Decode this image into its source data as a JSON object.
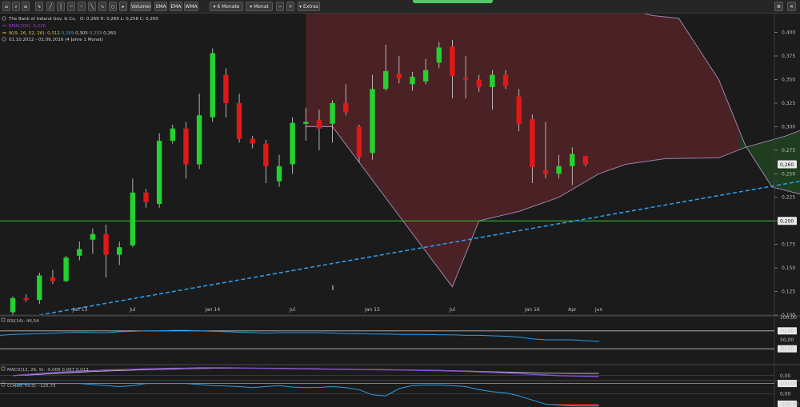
{
  "toolbar": {
    "buttons": [
      {
        "id": "tb-home",
        "label": "⌂"
      },
      {
        "id": "tb-zoom",
        "label": "⌕"
      },
      {
        "id": "tb-list",
        "label": "≡"
      },
      {
        "id": "tb-d1",
        "label": "↳"
      },
      {
        "id": "tb-d2",
        "label": "╱"
      },
      {
        "id": "tb-d3",
        "label": "│"
      },
      {
        "id": "tb-d4",
        "label": "─"
      },
      {
        "id": "tb-d5",
        "label": "┄"
      },
      {
        "id": "tb-d6",
        "label": "╲"
      },
      {
        "id": "tb-d7",
        "label": "∿"
      },
      {
        "id": "tb-d8",
        "label": "○"
      },
      {
        "id": "tb-d9",
        "label": "▸"
      },
      {
        "id": "tb-volumen",
        "label": "Volumen"
      },
      {
        "id": "tb-sma",
        "label": "SMA"
      },
      {
        "id": "tb-ema",
        "label": "EMA"
      },
      {
        "id": "tb-wma",
        "label": "WMA"
      },
      {
        "id": "tb-range",
        "label": "▾ 6 Monate"
      },
      {
        "id": "tb-interval",
        "label": "▾ Monat"
      },
      {
        "id": "tb-minus",
        "label": "−"
      },
      {
        "id": "tb-plus",
        "label": "+"
      },
      {
        "id": "tb-extras",
        "label": "▾ Extras"
      },
      {
        "id": "tb-settings",
        "label": "⚙"
      },
      {
        "id": "tb-close",
        "label": "✕"
      }
    ]
  },
  "legend": {
    "instrument": "The Bank of Ireland Gov. & Co.",
    "ohlc": "O: 0,269  H: 0,269  L: 0,258  C: 0,260",
    "ema": "EMA(200): 0,226",
    "ichimoku_label": "IK(9, 26, 52, 26): ",
    "ichimoku_v1": "0,312",
    "ichimoku_v2": "0,269",
    "ichimoku_v3": "0,305",
    "ichimoku_v4": "0,233",
    "ichimoku_v5": "0,260",
    "period": "01.10.2012 - 01.06.2016 (4 Jahre 1 Monat)"
  },
  "panels": {
    "rsi_label": "RSI(14): 46,54",
    "macd_label": "MACD(12, 26, 9): -0,005  0,007  0,013",
    "cci_label": "CCI(20, hlc3): -125,73"
  },
  "colors": {
    "up": "#22d22e",
    "down": "#e01818",
    "cloud_red": "#4a2124",
    "cloud_green": "#1e3e1f",
    "cloud_line": "#9a84b2",
    "trend": "#2d9be8",
    "hline": "#37c837",
    "rsi": "#2e9be8",
    "macd": "#8a4fd8",
    "cci_fill": "#1de11d",
    "cci_neg": "#e02020"
  },
  "chart_data": [
    {
      "type": "candlestick",
      "title": "The Bank of Ireland Gov. & Co.",
      "ylim": [
        0.1,
        0.42
      ],
      "yticks": [
        "0,400",
        "0,375",
        "0,350",
        "0,325",
        "0,300",
        "0,275",
        "0,250",
        "0,225",
        "0,200",
        "0,175",
        "0,150",
        "0,125",
        "0,100"
      ],
      "ytick_values": [
        0.4,
        0.375,
        0.35,
        0.325,
        0.3,
        0.275,
        0.25,
        0.225,
        0.2,
        0.175,
        0.15,
        0.125,
        0.1
      ],
      "x_index_range": [
        0,
        44
      ],
      "xticks": [
        {
          "label": "Jan 13",
          "i": 3
        },
        {
          "label": "Jul",
          "i": 9
        },
        {
          "label": "Jan 14",
          "i": 15
        },
        {
          "label": "Jul",
          "i": 21
        },
        {
          "label": "Jan 15",
          "i": 27
        },
        {
          "label": "Jul",
          "i": 33
        },
        {
          "label": "Jan 16",
          "i": 39
        },
        {
          "label": "Apr",
          "i": 42
        },
        {
          "label": "Jun",
          "i": 44
        }
      ],
      "candles": [
        {
          "o": 0.103,
          "h": 0.12,
          "l": 0.1,
          "c": 0.118
        },
        {
          "o": 0.118,
          "h": 0.122,
          "l": 0.114,
          "c": 0.116
        },
        {
          "o": 0.116,
          "h": 0.145,
          "l": 0.112,
          "c": 0.142
        },
        {
          "o": 0.14,
          "h": 0.148,
          "l": 0.133,
          "c": 0.136
        },
        {
          "o": 0.136,
          "h": 0.163,
          "l": 0.135,
          "c": 0.161
        },
        {
          "o": 0.163,
          "h": 0.178,
          "l": 0.158,
          "c": 0.17
        },
        {
          "o": 0.18,
          "h": 0.192,
          "l": 0.165,
          "c": 0.186
        },
        {
          "o": 0.186,
          "h": 0.196,
          "l": 0.14,
          "c": 0.164
        },
        {
          "o": 0.164,
          "h": 0.178,
          "l": 0.153,
          "c": 0.172
        },
        {
          "o": 0.174,
          "h": 0.245,
          "l": 0.172,
          "c": 0.23
        },
        {
          "o": 0.23,
          "h": 0.234,
          "l": 0.214,
          "c": 0.22
        },
        {
          "o": 0.218,
          "h": 0.293,
          "l": 0.214,
          "c": 0.285
        },
        {
          "o": 0.285,
          "h": 0.302,
          "l": 0.282,
          "c": 0.298
        },
        {
          "o": 0.298,
          "h": 0.305,
          "l": 0.245,
          "c": 0.26
        },
        {
          "o": 0.26,
          "h": 0.335,
          "l": 0.255,
          "c": 0.312
        },
        {
          "o": 0.31,
          "h": 0.383,
          "l": 0.305,
          "c": 0.378
        },
        {
          "o": 0.355,
          "h": 0.362,
          "l": 0.31,
          "c": 0.325
        },
        {
          "o": 0.325,
          "h": 0.335,
          "l": 0.283,
          "c": 0.287
        },
        {
          "o": 0.287,
          "h": 0.29,
          "l": 0.277,
          "c": 0.282
        },
        {
          "o": 0.282,
          "h": 0.286,
          "l": 0.24,
          "c": 0.258
        },
        {
          "o": 0.242,
          "h": 0.27,
          "l": 0.236,
          "c": 0.258
        },
        {
          "o": 0.26,
          "h": 0.31,
          "l": 0.25,
          "c": 0.304
        },
        {
          "o": 0.303,
          "h": 0.32,
          "l": 0.285,
          "c": 0.305
        },
        {
          "o": 0.307,
          "h": 0.318,
          "l": 0.275,
          "c": 0.298
        },
        {
          "o": 0.303,
          "h": 0.328,
          "l": 0.283,
          "c": 0.325
        },
        {
          "o": 0.325,
          "h": 0.345,
          "l": 0.312,
          "c": 0.315
        },
        {
          "o": 0.3,
          "h": 0.302,
          "l": 0.262,
          "c": 0.268
        },
        {
          "o": 0.272,
          "h": 0.355,
          "l": 0.265,
          "c": 0.34
        },
        {
          "o": 0.34,
          "h": 0.387,
          "l": 0.338,
          "c": 0.359
        },
        {
          "o": 0.356,
          "h": 0.375,
          "l": 0.346,
          "c": 0.351
        },
        {
          "o": 0.345,
          "h": 0.358,
          "l": 0.338,
          "c": 0.353
        },
        {
          "o": 0.348,
          "h": 0.372,
          "l": 0.345,
          "c": 0.36
        },
        {
          "o": 0.368,
          "h": 0.39,
          "l": 0.362,
          "c": 0.384
        },
        {
          "o": 0.385,
          "h": 0.392,
          "l": 0.33,
          "c": 0.354
        },
        {
          "o": 0.352,
          "h": 0.375,
          "l": 0.33,
          "c": 0.35
        },
        {
          "o": 0.35,
          "h": 0.355,
          "l": 0.337,
          "c": 0.342
        },
        {
          "o": 0.342,
          "h": 0.36,
          "l": 0.318,
          "c": 0.355
        },
        {
          "o": 0.355,
          "h": 0.36,
          "l": 0.34,
          "c": 0.343
        },
        {
          "o": 0.332,
          "h": 0.34,
          "l": 0.295,
          "c": 0.303
        },
        {
          "o": 0.308,
          "h": 0.313,
          "l": 0.24,
          "c": 0.257
        },
        {
          "o": 0.254,
          "h": 0.305,
          "l": 0.245,
          "c": 0.25
        },
        {
          "o": 0.25,
          "h": 0.27,
          "l": 0.245,
          "c": 0.258
        },
        {
          "o": 0.258,
          "h": 0.278,
          "l": 0.238,
          "c": 0.271
        },
        {
          "o": 0.269,
          "h": 0.269,
          "l": 0.258,
          "c": 0.26
        }
      ],
      "cloud_upper": [
        [
          22,
          0.3
        ],
        [
          23,
          0.3
        ],
        [
          24,
          0.3
        ],
        [
          33,
          0.13
        ],
        [
          35,
          0.2
        ],
        [
          38,
          0.21
        ],
        [
          41,
          0.225
        ],
        [
          44,
          0.25
        ],
        [
          46,
          0.26
        ],
        [
          49,
          0.266
        ],
        [
          53,
          0.267
        ],
        [
          55,
          0.278
        ],
        [
          58,
          0.29
        ],
        [
          59.5,
          0.298
        ]
      ],
      "cloud_lower": [
        [
          22,
          0.44
        ],
        [
          26,
          0.44
        ],
        [
          30,
          0.45
        ],
        [
          35,
          0.44
        ],
        [
          40,
          0.435
        ],
        [
          45,
          0.43
        ],
        [
          48,
          0.418
        ],
        [
          50,
          0.415
        ],
        [
          53,
          0.35
        ],
        [
          55,
          0.28
        ],
        [
          57,
          0.236
        ],
        [
          59.5,
          0.227
        ]
      ],
      "trendline": [
        [
          2,
          0.1
        ],
        [
          59.5,
          0.243
        ]
      ],
      "hline": 0.2,
      "last_price": "0,260",
      "hline_label": "0,200"
    },
    {
      "type": "line",
      "title": "RSI(14): 46,54",
      "ylim": [
        0,
        100
      ],
      "yticks": [
        "100,00",
        "70,00",
        "50,00",
        "30,00"
      ],
      "ytick_values": [
        100,
        70,
        50,
        30
      ],
      "values": [
        60,
        62,
        63,
        64,
        65,
        66,
        67,
        66,
        66,
        68,
        69,
        70,
        70,
        71,
        71,
        70,
        69,
        68,
        67,
        66,
        65,
        66,
        66,
        66,
        66,
        65,
        64,
        64,
        63,
        63,
        62,
        62,
        62,
        61,
        61,
        60,
        60,
        59,
        58,
        56,
        52,
        50,
        50,
        50,
        48,
        46.5
      ]
    },
    {
      "type": "line",
      "title": "MACD(12, 26, 9): -0,005  0,007  0,013",
      "ylim": [
        -0.02,
        0.06
      ],
      "yticks": [
        "0,00"
      ],
      "ytick_values": [
        0
      ],
      "macd": [
        0.0,
        0.006,
        0.012,
        0.018,
        0.022,
        0.026,
        0.03,
        0.033,
        0.035,
        0.037,
        0.04,
        0.041,
        0.043,
        0.044,
        0.046,
        0.046,
        0.046,
        0.045,
        0.044,
        0.043,
        0.042,
        0.041,
        0.04,
        0.039,
        0.038,
        0.037,
        0.036,
        0.035,
        0.034,
        0.033,
        0.032,
        0.03,
        0.029,
        0.027,
        0.025,
        0.022,
        0.019,
        0.016,
        0.012,
        0.008,
        0.004,
        0.0,
        -0.002,
        -0.004,
        -0.005
      ],
      "signal": [
        0.0,
        0.003,
        0.007,
        0.012,
        0.016,
        0.02,
        0.024,
        0.027,
        0.03,
        0.032,
        0.035,
        0.037,
        0.039,
        0.041,
        0.042,
        0.043,
        0.044,
        0.044,
        0.044,
        0.043,
        0.043,
        0.042,
        0.041,
        0.04,
        0.039,
        0.038,
        0.037,
        0.036,
        0.035,
        0.034,
        0.033,
        0.032,
        0.031,
        0.029,
        0.027,
        0.025,
        0.023,
        0.021,
        0.019,
        0.017,
        0.015,
        0.014,
        0.013,
        0.013,
        0.013
      ]
    },
    {
      "type": "area",
      "title": "CCI(20, hlc3): -125,73",
      "ylim": [
        -100,
        100
      ],
      "yticks": [
        "100,00",
        "0,00",
        "-100,00"
      ],
      "ytick_values": [
        100,
        0,
        -100
      ],
      "values": [
        80,
        95,
        100,
        100,
        100,
        100,
        90,
        80,
        70,
        80,
        100,
        100,
        100,
        100,
        90,
        80,
        75,
        70,
        60,
        70,
        80,
        65,
        60,
        62,
        70,
        60,
        40,
        -10,
        -20,
        50,
        80,
        85,
        85,
        80,
        70,
        40,
        20,
        10,
        -20,
        -60,
        -100,
        -110,
        -125,
        -125.7,
        -125.7
      ],
      "overbought": 100,
      "oversold": -100
    }
  ]
}
